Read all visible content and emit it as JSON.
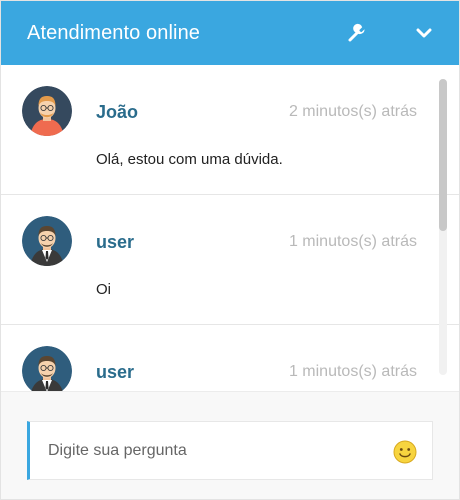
{
  "header": {
    "title": "Atendimento online",
    "settings_icon": "wrench-icon",
    "collapse_icon": "chevron-down-icon",
    "background": "#3aa7e0"
  },
  "messages": [
    {
      "sender": "João",
      "time": "2 minutos(s) atrás",
      "text": "Olá, estou com uma dúvida.",
      "avatar": "avatar-orange-shirt"
    },
    {
      "sender": "user",
      "time": "1 minutos(s) atrás",
      "text": "Oi",
      "avatar": "avatar-suit"
    },
    {
      "sender": "user",
      "time": "1 minutos(s) atrás",
      "text": "",
      "avatar": "avatar-suit"
    }
  ],
  "composer": {
    "placeholder": "Digite sua pergunta",
    "value": "",
    "emoji_icon": "smiley-icon"
  },
  "colors": {
    "accent": "#3aa7e0",
    "sender": "#2a6c8c",
    "timestamp": "#b9b9b9"
  }
}
